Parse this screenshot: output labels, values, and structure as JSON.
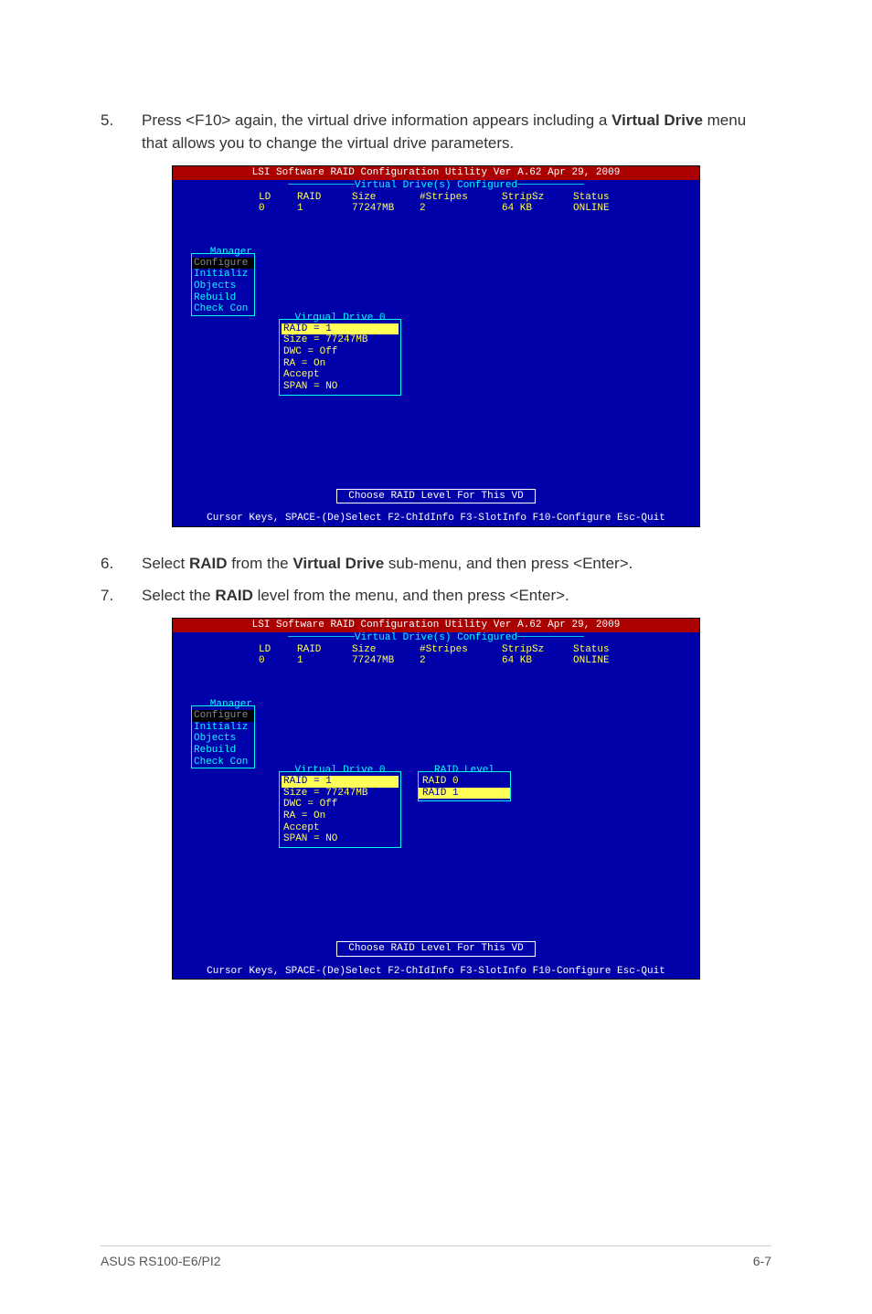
{
  "steps": {
    "s5_num": "5.",
    "s5_txt_a": "Press <F10> again, the virtual drive information appears including a ",
    "s5_txt_b": "Virtual Drive",
    "s5_txt_c": " menu that allows you to change the virtual drive parameters.",
    "s6_num": "6.",
    "s6_txt_a": "Select ",
    "s6_txt_b": "RAID",
    "s6_txt_c": " from the ",
    "s6_txt_d": "Virtual Drive",
    "s6_txt_e": " sub-menu, and then press <Enter>.",
    "s7_num": "7.",
    "s7_txt_a": "Select the ",
    "s7_txt_b": "RAID",
    "s7_txt_c": " level from the menu, and then press <Enter>."
  },
  "ss": {
    "title": "LSI Software RAID Configuration Utility Ver A.62 Apr 29, 2009",
    "subtitle": "Virtual Drive(s) Configured",
    "th_ld": "LD",
    "th_raid": "RAID",
    "th_size": "Size",
    "th_str": "#Stripes",
    "th_sz": "StripSz",
    "th_stat": "Status",
    "td_ld": "0",
    "td_raid": "1",
    "td_size": "77247MB",
    "td_str": "2",
    "td_sz": "64 KB",
    "td_stat": "ONLINE",
    "sb_title": "Manager",
    "sb1": "Configure",
    "sb2": "Initializ",
    "sb3": "Objects",
    "sb4": "Rebuild",
    "sb5": "Check Con",
    "vd_title1": "Virgual Drive 0",
    "vd_title2": "Virtual Drive 0",
    "vd1": "RAID = 1",
    "vd2": "Size = 77247MB",
    "vd3": "DWC  = Off",
    "vd4": "RA   = On",
    "vd5": "Accept",
    "vd6": "SPAN = NO",
    "rl_title": "RAID Level",
    "rl0": "RAID 0",
    "rl1": "RAID 1",
    "hint": "Choose RAID Level For This VD",
    "footer": "Cursor Keys, SPACE-(De)Select F2-ChIdInfo F3-SlotInfo F10-Configure Esc-Quit"
  },
  "page": {
    "model": "ASUS RS100-E6/PI2",
    "num": "6-7"
  }
}
